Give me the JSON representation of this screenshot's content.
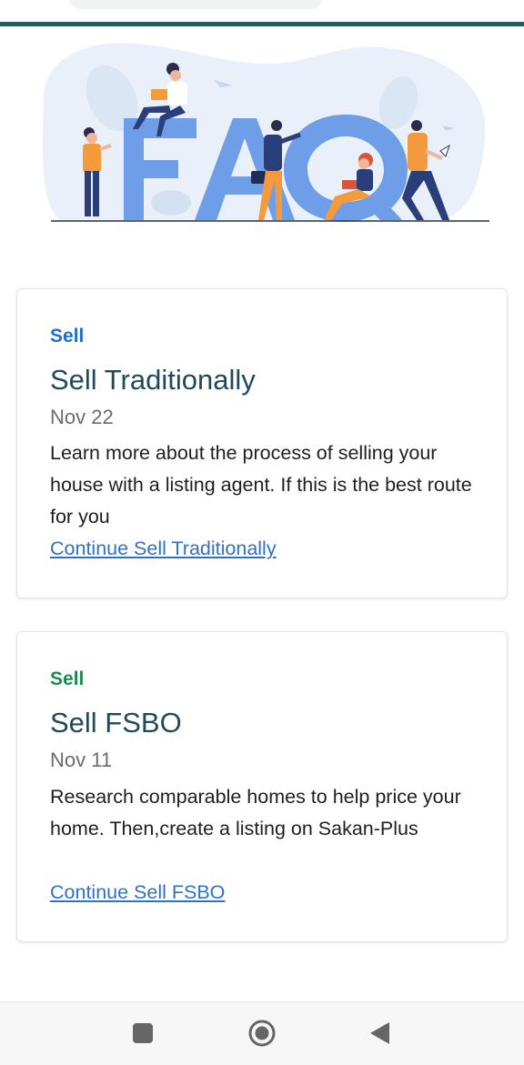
{
  "hero": {
    "illustration_text": "FAQ"
  },
  "cards": [
    {
      "category": "Sell",
      "category_color": "#1c6fd6",
      "title": "Sell Traditionally",
      "date": "Nov 22",
      "description": "Learn more about the process of selling your house with a listing agent. If this is the best route for you",
      "link": "Continue Sell Traditionally"
    },
    {
      "category": "Sell",
      "category_color": "#1f8a4e",
      "title": "Sell FSBO",
      "date": "Nov 11",
      "description": "Research comparable homes to help price your home. Then,create a listing on Sakan-Plus",
      "link": "Continue Sell FSBO"
    }
  ],
  "nav": {
    "recent_icon": "square-icon",
    "home_icon": "circle-icon",
    "back_icon": "triangle-back-icon"
  },
  "colors": {
    "accent_bar": "#245b5c",
    "title": "#1f4a5a",
    "link": "#2e72c8",
    "faq_letters": "#6f9ee8"
  }
}
